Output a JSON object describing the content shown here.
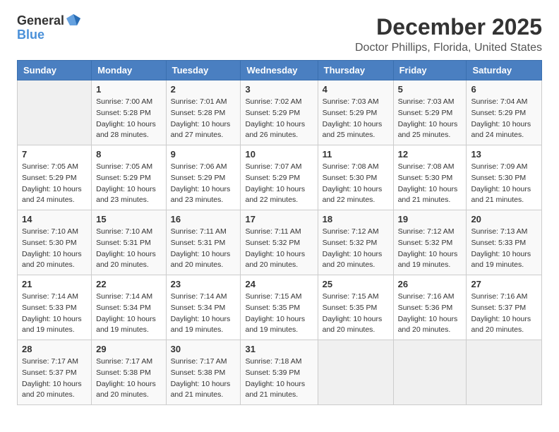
{
  "logo": {
    "text_general": "General",
    "text_blue": "Blue",
    "icon_label": "general-blue-logo"
  },
  "calendar": {
    "title": "December 2025",
    "subtitle": "Doctor Phillips, Florida, United States",
    "days_of_week": [
      "Sunday",
      "Monday",
      "Tuesday",
      "Wednesday",
      "Thursday",
      "Friday",
      "Saturday"
    ],
    "weeks": [
      [
        {
          "day": "",
          "empty": true
        },
        {
          "day": "1",
          "sunrise": "Sunrise: 7:00 AM",
          "sunset": "Sunset: 5:28 PM",
          "daylight": "Daylight: 10 hours and 28 minutes."
        },
        {
          "day": "2",
          "sunrise": "Sunrise: 7:01 AM",
          "sunset": "Sunset: 5:28 PM",
          "daylight": "Daylight: 10 hours and 27 minutes."
        },
        {
          "day": "3",
          "sunrise": "Sunrise: 7:02 AM",
          "sunset": "Sunset: 5:29 PM",
          "daylight": "Daylight: 10 hours and 26 minutes."
        },
        {
          "day": "4",
          "sunrise": "Sunrise: 7:03 AM",
          "sunset": "Sunset: 5:29 PM",
          "daylight": "Daylight: 10 hours and 25 minutes."
        },
        {
          "day": "5",
          "sunrise": "Sunrise: 7:03 AM",
          "sunset": "Sunset: 5:29 PM",
          "daylight": "Daylight: 10 hours and 25 minutes."
        },
        {
          "day": "6",
          "sunrise": "Sunrise: 7:04 AM",
          "sunset": "Sunset: 5:29 PM",
          "daylight": "Daylight: 10 hours and 24 minutes."
        }
      ],
      [
        {
          "day": "7",
          "sunrise": "Sunrise: 7:05 AM",
          "sunset": "Sunset: 5:29 PM",
          "daylight": "Daylight: 10 hours and 24 minutes."
        },
        {
          "day": "8",
          "sunrise": "Sunrise: 7:05 AM",
          "sunset": "Sunset: 5:29 PM",
          "daylight": "Daylight: 10 hours and 23 minutes."
        },
        {
          "day": "9",
          "sunrise": "Sunrise: 7:06 AM",
          "sunset": "Sunset: 5:29 PM",
          "daylight": "Daylight: 10 hours and 23 minutes."
        },
        {
          "day": "10",
          "sunrise": "Sunrise: 7:07 AM",
          "sunset": "Sunset: 5:29 PM",
          "daylight": "Daylight: 10 hours and 22 minutes."
        },
        {
          "day": "11",
          "sunrise": "Sunrise: 7:08 AM",
          "sunset": "Sunset: 5:30 PM",
          "daylight": "Daylight: 10 hours and 22 minutes."
        },
        {
          "day": "12",
          "sunrise": "Sunrise: 7:08 AM",
          "sunset": "Sunset: 5:30 PM",
          "daylight": "Daylight: 10 hours and 21 minutes."
        },
        {
          "day": "13",
          "sunrise": "Sunrise: 7:09 AM",
          "sunset": "Sunset: 5:30 PM",
          "daylight": "Daylight: 10 hours and 21 minutes."
        }
      ],
      [
        {
          "day": "14",
          "sunrise": "Sunrise: 7:10 AM",
          "sunset": "Sunset: 5:30 PM",
          "daylight": "Daylight: 10 hours and 20 minutes."
        },
        {
          "day": "15",
          "sunrise": "Sunrise: 7:10 AM",
          "sunset": "Sunset: 5:31 PM",
          "daylight": "Daylight: 10 hours and 20 minutes."
        },
        {
          "day": "16",
          "sunrise": "Sunrise: 7:11 AM",
          "sunset": "Sunset: 5:31 PM",
          "daylight": "Daylight: 10 hours and 20 minutes."
        },
        {
          "day": "17",
          "sunrise": "Sunrise: 7:11 AM",
          "sunset": "Sunset: 5:32 PM",
          "daylight": "Daylight: 10 hours and 20 minutes."
        },
        {
          "day": "18",
          "sunrise": "Sunrise: 7:12 AM",
          "sunset": "Sunset: 5:32 PM",
          "daylight": "Daylight: 10 hours and 20 minutes."
        },
        {
          "day": "19",
          "sunrise": "Sunrise: 7:12 AM",
          "sunset": "Sunset: 5:32 PM",
          "daylight": "Daylight: 10 hours and 19 minutes."
        },
        {
          "day": "20",
          "sunrise": "Sunrise: 7:13 AM",
          "sunset": "Sunset: 5:33 PM",
          "daylight": "Daylight: 10 hours and 19 minutes."
        }
      ],
      [
        {
          "day": "21",
          "sunrise": "Sunrise: 7:14 AM",
          "sunset": "Sunset: 5:33 PM",
          "daylight": "Daylight: 10 hours and 19 minutes."
        },
        {
          "day": "22",
          "sunrise": "Sunrise: 7:14 AM",
          "sunset": "Sunset: 5:34 PM",
          "daylight": "Daylight: 10 hours and 19 minutes."
        },
        {
          "day": "23",
          "sunrise": "Sunrise: 7:14 AM",
          "sunset": "Sunset: 5:34 PM",
          "daylight": "Daylight: 10 hours and 19 minutes."
        },
        {
          "day": "24",
          "sunrise": "Sunrise: 7:15 AM",
          "sunset": "Sunset: 5:35 PM",
          "daylight": "Daylight: 10 hours and 19 minutes."
        },
        {
          "day": "25",
          "sunrise": "Sunrise: 7:15 AM",
          "sunset": "Sunset: 5:35 PM",
          "daylight": "Daylight: 10 hours and 20 minutes."
        },
        {
          "day": "26",
          "sunrise": "Sunrise: 7:16 AM",
          "sunset": "Sunset: 5:36 PM",
          "daylight": "Daylight: 10 hours and 20 minutes."
        },
        {
          "day": "27",
          "sunrise": "Sunrise: 7:16 AM",
          "sunset": "Sunset: 5:37 PM",
          "daylight": "Daylight: 10 hours and 20 minutes."
        }
      ],
      [
        {
          "day": "28",
          "sunrise": "Sunrise: 7:17 AM",
          "sunset": "Sunset: 5:37 PM",
          "daylight": "Daylight: 10 hours and 20 minutes."
        },
        {
          "day": "29",
          "sunrise": "Sunrise: 7:17 AM",
          "sunset": "Sunset: 5:38 PM",
          "daylight": "Daylight: 10 hours and 20 minutes."
        },
        {
          "day": "30",
          "sunrise": "Sunrise: 7:17 AM",
          "sunset": "Sunset: 5:38 PM",
          "daylight": "Daylight: 10 hours and 21 minutes."
        },
        {
          "day": "31",
          "sunrise": "Sunrise: 7:18 AM",
          "sunset": "Sunset: 5:39 PM",
          "daylight": "Daylight: 10 hours and 21 minutes."
        },
        {
          "day": "",
          "empty": true
        },
        {
          "day": "",
          "empty": true
        },
        {
          "day": "",
          "empty": true
        }
      ]
    ]
  }
}
